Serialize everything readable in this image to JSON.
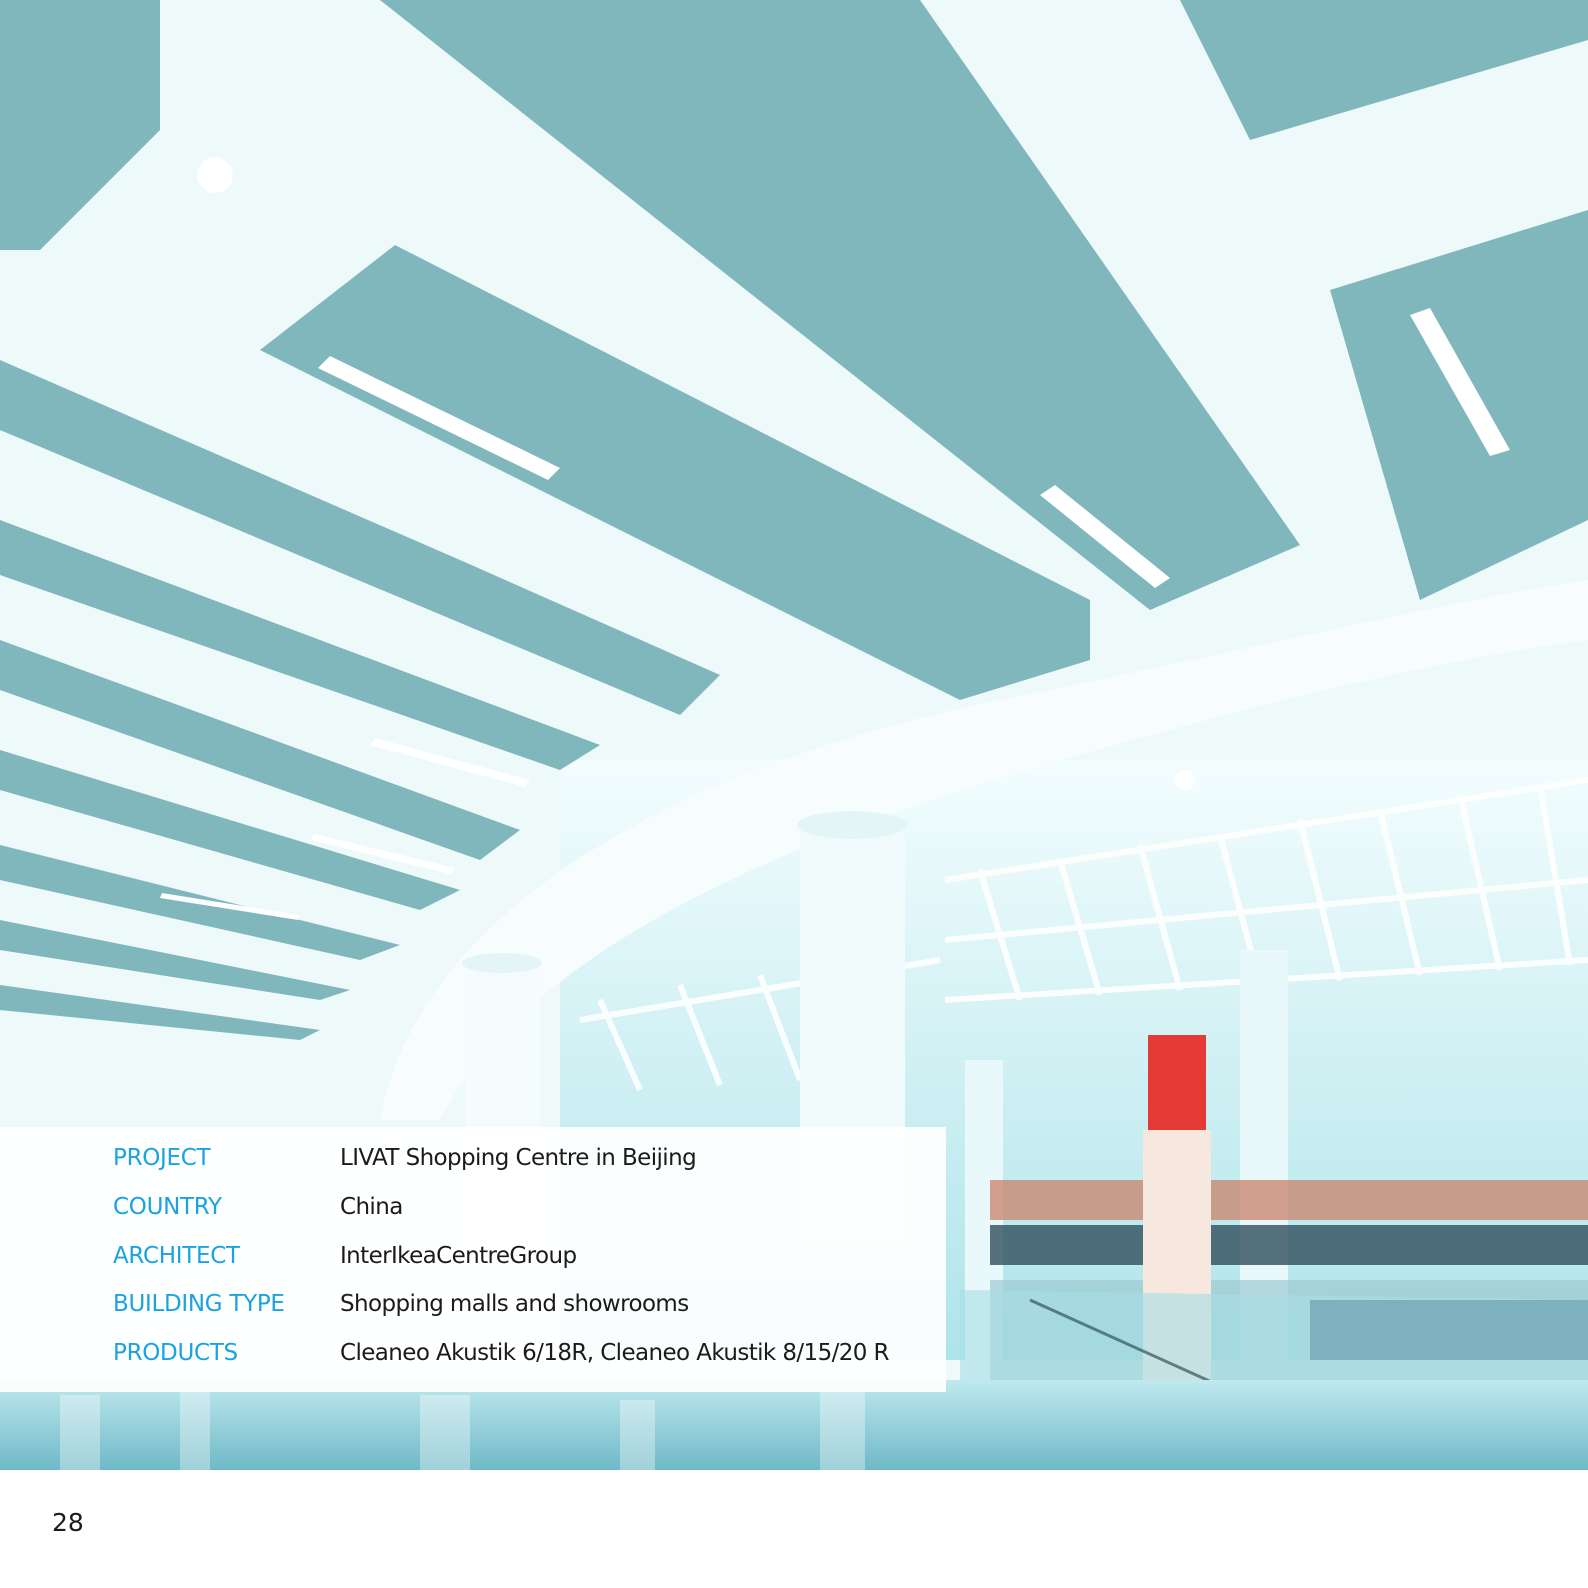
{
  "colors": {
    "label_blue": "#1aa3e0",
    "text_dark": "#1b1b1b",
    "ceiling_panel": "#7fb7bc",
    "ceiling_white": "#f4fbfb"
  },
  "project_info": {
    "rows": [
      {
        "label": "PROJECT",
        "value": "LIVAT Shopping Centre in Beijing"
      },
      {
        "label": "COUNTRY",
        "value": "China"
      },
      {
        "label": "ARCHITECT",
        "value": "InterIkeaCentreGroup"
      },
      {
        "label": "BUILDING TYPE",
        "value": "Shopping malls and showrooms"
      },
      {
        "label": "PRODUCTS",
        "value": "Cleaneo Akustik 6/18R, Cleaneo Akustik 8/15/20 R"
      }
    ]
  },
  "page": {
    "number": "28"
  }
}
